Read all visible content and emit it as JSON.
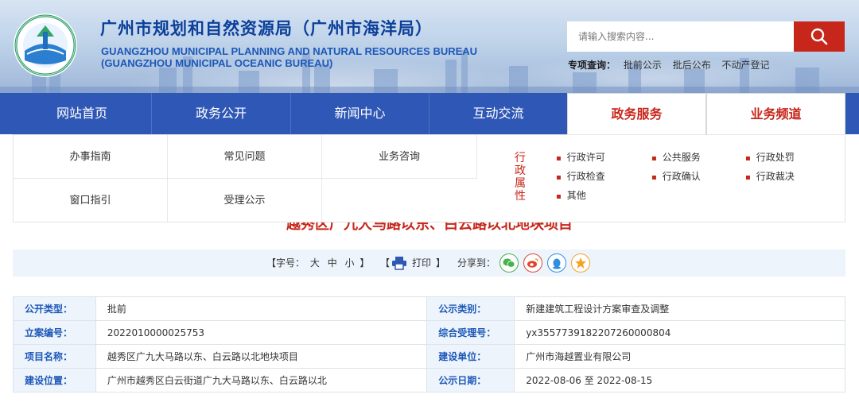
{
  "header": {
    "title_cn": "广州市规划和自然资源局（广州市海洋局）",
    "title_en_line1": "GUANGZHOU MUNICIPAL PLANNING AND NATURAL RESOURCES BUREAU",
    "title_en_line2": "(GUANGZHOU MUNICIPAL OCEANIC BUREAU)",
    "search_placeholder": "请输入搜索内容...",
    "special_label": "专项查询：",
    "special_links": [
      "批前公示",
      "批后公布",
      "不动产登记"
    ]
  },
  "nav": {
    "items": [
      "网站首页",
      "政务公开",
      "新闻中心",
      "互动交流",
      "政务服务",
      "业务频道"
    ],
    "active": "政务服务"
  },
  "dropdown": {
    "row1": [
      "办事指南",
      "常见问题",
      "业务咨询"
    ],
    "row2": [
      "窗口指引",
      "受理公示"
    ],
    "attr_label": "行政属性",
    "attr_items": [
      "行政许可",
      "公共服务",
      "行政处罚",
      "行政检查",
      "行政确认",
      "行政裁决",
      "其他"
    ]
  },
  "page_title": "越秀区广九大马路以东、白云路以北地块项目",
  "toolbar": {
    "font_label": "【字号：",
    "font_sizes": [
      "大",
      "中",
      "小"
    ],
    "font_end": "】",
    "print_open": "【",
    "print_label": "打印",
    "print_close": "】",
    "share_label": "分享到："
  },
  "info": {
    "rows": [
      {
        "k1": "公开类型：",
        "v1": "批前",
        "k2": "公示类别：",
        "v2": "新建建筑工程设计方案审查及调整"
      },
      {
        "k1": "立案编号：",
        "v1": "2022010000025753",
        "k2": "综合受理号：",
        "v2": "yx355773918220726000080 4"
      },
      {
        "k1": "项目名称：",
        "v1": "越秀区广九大马路以东、白云路以北地块项目",
        "k2": "建设单位：",
        "v2": "广州市海越置业有限公司"
      },
      {
        "k1": "建设位置：",
        "v1": "广州市越秀区白云街道广九大马路以东、白云路以北",
        "k2": "公示日期：",
        "v2": "2022-08-06 至 2022-08-15"
      }
    ]
  },
  "colors": {
    "brand_blue": "#2f57b5",
    "title_blue": "#0b3f9a",
    "accent_red": "#c7261a",
    "label_blue": "#1d58b8"
  }
}
